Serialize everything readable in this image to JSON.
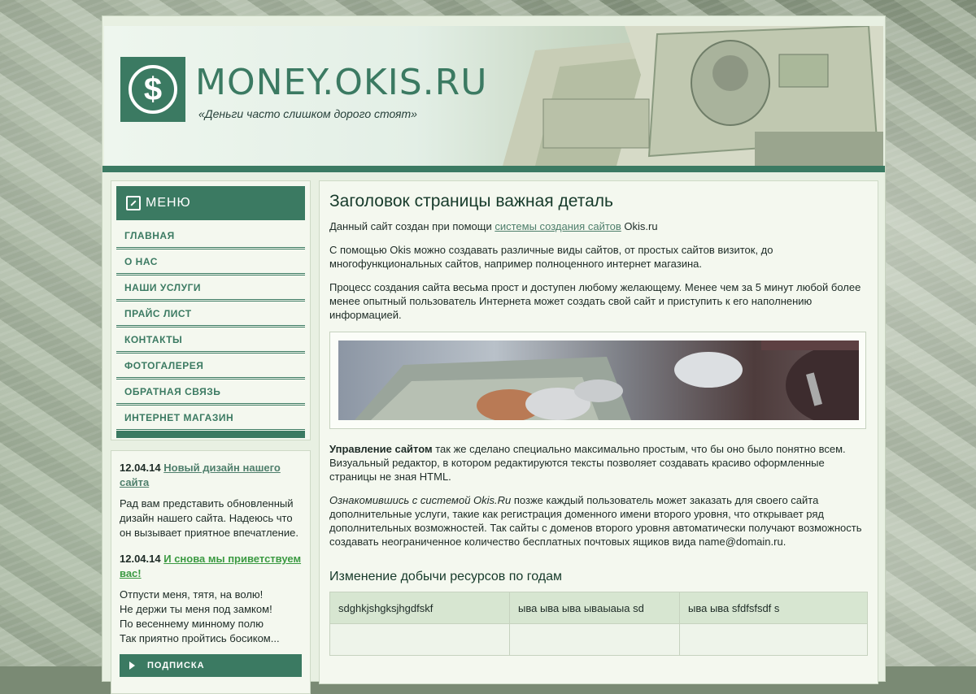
{
  "site": {
    "title": "MONEY.OKIS.RU",
    "slogan": "«Деньги часто слишком дорого стоят»",
    "logo_symbol": "$",
    "accent_color": "#3b7a62"
  },
  "menu": {
    "heading": "МЕНЮ",
    "items": [
      {
        "label": "ГЛАВНАЯ"
      },
      {
        "label": "О НАС"
      },
      {
        "label": "НАШИ УСЛУГИ"
      },
      {
        "label": "ПРАЙС ЛИСТ"
      },
      {
        "label": "КОНТАКТЫ"
      },
      {
        "label": "ФОТОГАЛЕРЕЯ"
      },
      {
        "label": "ОБРАТНАЯ СВЯЗЬ"
      },
      {
        "label": "ИНТЕРНЕТ МАГАЗИН"
      }
    ]
  },
  "news": [
    {
      "date": "12.04.14",
      "title": "Новый дизайн нашего сайта",
      "text": "Рад вам представить обновленный дизайн нашего сайта. Надеюсь что он вызывает приятное впечатление."
    },
    {
      "date": "12.04.14",
      "title": "И снова мы приветствуем вас!",
      "lines": [
        "Отпусти меня, тятя, на волю!",
        "Не держи ты меня под замком!",
        "По весеннему минному полю",
        "Так приятно пройтись босиком..."
      ]
    }
  ],
  "subscribe_label": "ПОДПИСКА",
  "main": {
    "heading": "Заголовок страницы важная деталь",
    "p1_before": "Данный сайт создан при помощи ",
    "p1_link": "системы создания сайтов",
    "p1_after": " Okis.ru",
    "p2": "С помощью Okis можно создавать различные виды сайтов, от простых сайтов визиток, до многофункциональных сайтов, например полноценного интернет магазина.",
    "p3": "Процесс создания сайта весьма прост и доступен любому желающему. Менее чем за 5 минут любой более менее опытный пользователь Интернета может создать свой сайт и приступить к его наполнению информацией.",
    "p4_bold": "Управление сайтом",
    "p4_rest": " так же сделано специально максимально простым, что бы оно было понятно всем. Визуальный редактор, в котором редактируются тексты позволяет создавать красиво оформленные страницы не зная HTML.",
    "p5_italic": "Ознакомившись с системой Okis.Ru",
    "p5_rest": " позже каждый пользователь может заказать для своего сайта дополнительные услуги, такие как регистрация доменного имени второго уровня, что открывает ряд дополнительных возможностей. Так сайты с доменов второго уровня автоматически получают возможность создавать неограниченное количество бесплатных почтовых ящиков вида name@domain.ru.",
    "table_heading": "Изменение добычи ресурсов по годам",
    "table_rows": [
      [
        "sdghkjshgksjhgdfskf",
        "ыва ыва ыва ывaыаыа sd",
        "ыва ыва sfdfsfsdf s"
      ],
      [
        "",
        "",
        ""
      ]
    ]
  }
}
